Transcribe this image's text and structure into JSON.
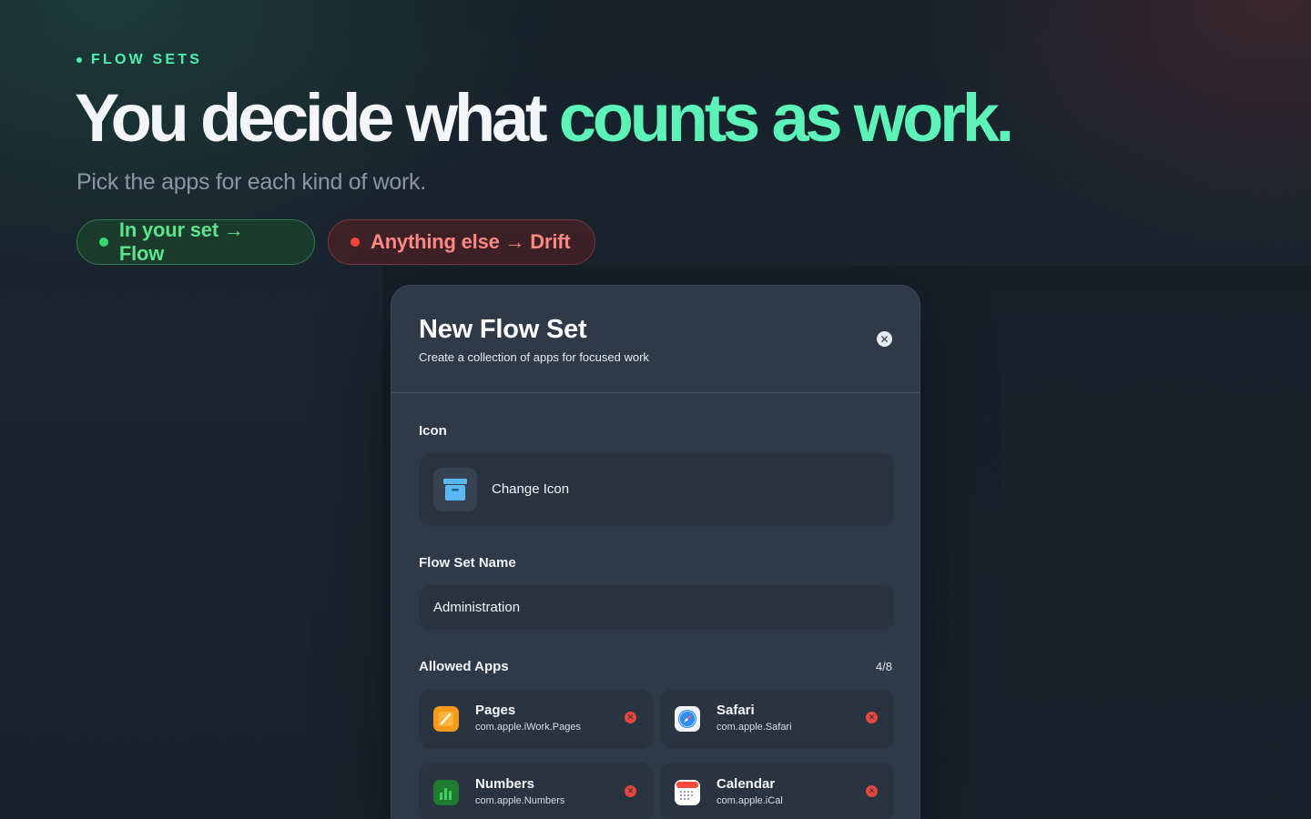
{
  "hero": {
    "eyebrow": "FLOW SETS",
    "headline_white": "You decide what ",
    "headline_green": "counts as work.",
    "subtitle": "Pick the apps for each kind of work.",
    "pill_flow": "In your set → Flow",
    "pill_drift": "Anything else → Drift"
  },
  "sheet": {
    "title": "New Flow Set",
    "subtitle": "Create a collection of apps for focused work",
    "close_glyph": "✕",
    "icon_label": "Icon",
    "change_icon_label": "Change Icon",
    "name_label": "Flow Set Name",
    "name_value": "Administration",
    "allowed_label": "Allowed Apps",
    "allowed_count": "4/8",
    "remove_glyph": "✕",
    "apps": [
      {
        "name": "Pages",
        "bundle_id": "com.apple.iWork.Pages",
        "icon": "pages-icon"
      },
      {
        "name": "Safari",
        "bundle_id": "com.apple.Safari",
        "icon": "safari-icon"
      },
      {
        "name": "Numbers",
        "bundle_id": "com.apple.Numbers",
        "icon": "numbers-icon"
      },
      {
        "name": "Calendar",
        "bundle_id": "com.apple.iCal",
        "icon": "calendar-icon"
      }
    ]
  },
  "colors": {
    "accent_green": "#5cf2b8",
    "flow_green": "#35d86b",
    "drift_red": "#ff453a",
    "sheet_bg": "#2f3a49",
    "field_bg": "#2a3340"
  }
}
